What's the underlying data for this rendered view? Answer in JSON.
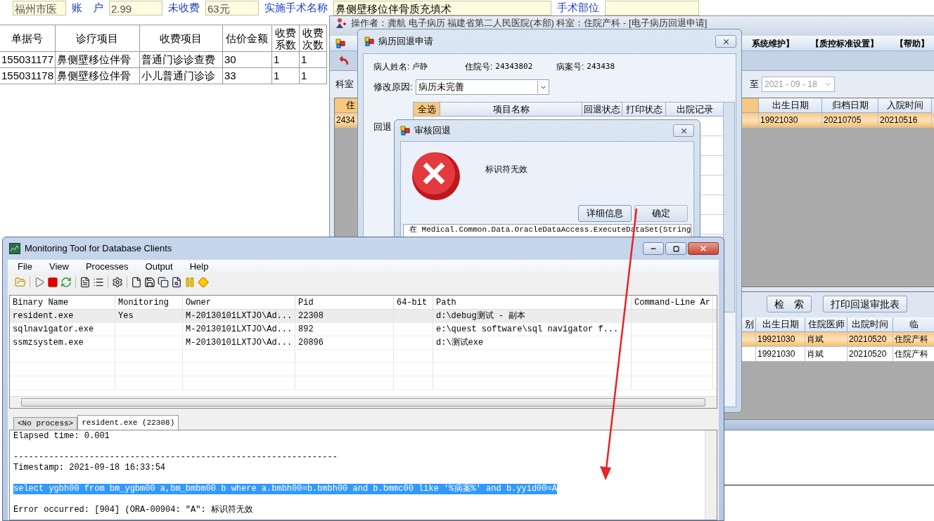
{
  "background_form": {
    "fields": [
      {
        "value": "福州市医"
      },
      {
        "label": "账　户",
        "value": "2.99"
      },
      {
        "label": "未收费",
        "value": "63元"
      },
      {
        "label": "实施手术名称",
        "value": "鼻侧壁移位伴骨质充填术"
      },
      {
        "label": "手术部位"
      }
    ],
    "fee_table": {
      "columns": [
        "单据号",
        "诊疗项目",
        "收费项目",
        "估价金额",
        "收费系数",
        "收费次数"
      ],
      "rows": [
        [
          "155031177",
          "鼻侧壁移位伴骨",
          "普通门诊诊查费",
          "30",
          "1",
          "1"
        ],
        [
          "155031178",
          "鼻侧壁移位伴骨",
          "小儿普通门诊诊",
          "33",
          "1",
          "1"
        ]
      ]
    }
  },
  "emr_window": {
    "title": "操作者：龚航 电子病历 福建省第二人民医院(本部) 科室：住院产科 - [电子病历回退申请]",
    "menu": [
      "系统维护】",
      "【质控标准设置】",
      "【帮助】"
    ],
    "dept_label": "科室",
    "date_to_label": "至",
    "date_to": "2021 - 09 - 18",
    "archive_grid": {
      "columns": [
        "住",
        "出生日期",
        "归档日期",
        "入院时间"
      ],
      "rows": [
        {
          "cells": [
            "2434",
            "19921030",
            "20210705",
            "20210516"
          ],
          "selected": true
        }
      ]
    },
    "buttons": [
      "检　索",
      "打印回退审批表"
    ],
    "discharge_grid": {
      "columns": [
        "别",
        "出生日期",
        "住院医师",
        "出院时间",
        "临"
      ],
      "rows": [
        {
          "cells": [
            "",
            "19921030",
            "肖斌",
            "20210520",
            "住院产科"
          ],
          "selected": true
        },
        {
          "cells": [
            "",
            "19921030",
            "肖斌",
            "20210520",
            "住院产科"
          ],
          "selected": false
        }
      ]
    }
  },
  "apply_dialog": {
    "title": "病历回退申请",
    "patient": [
      {
        "label": "病人姓名:",
        "value": "卢静"
      },
      {
        "label": "住院号:",
        "value": "24343802"
      },
      {
        "label": "病案号:",
        "value": "243438"
      }
    ],
    "reason_label": "修改原因:",
    "reason": "病历未完善",
    "side_label": "回退",
    "items_columns": [
      "全选",
      "项目名称",
      "回退状态",
      "打印状态",
      "出院记录"
    ]
  },
  "error_dialog": {
    "title": "审核回退",
    "message": "标识符无效",
    "buttons": [
      "详细信息",
      "确定"
    ],
    "detail": "在 Medical.Common.Data.OracleDataAccess.ExecuteDataSet(String"
  },
  "monitor": {
    "title": "Monitoring Tool for Database Clients",
    "menu": [
      "File",
      "View",
      "Processes",
      "Output",
      "Help"
    ],
    "columns": [
      "Binary Name",
      "Monitoring",
      "Owner",
      "Pid",
      "64-bit",
      "Path",
      "Command-Line Ar"
    ],
    "rows": [
      {
        "binary": "resident.exe",
        "monitoring": "Yes",
        "owner": "M-20130101LXTJO\\Ad...",
        "pid": "22308",
        "path": "d:\\debug测试 - 副本",
        "selected": true
      },
      {
        "binary": "sqlnavigator.exe",
        "owner": "M-20130101LXTJO\\Ad...",
        "pid": "892",
        "path": "e:\\quest software\\sql navigator f...",
        "selected": false
      },
      {
        "binary": "ssmzsystem.exe",
        "owner": "M-20130101LXTJO\\Ad...",
        "pid": "20896",
        "path": "d:\\测试exe",
        "selected": false
      }
    ],
    "tabs": [
      {
        "label": "<No process>",
        "selected": false
      },
      {
        "label": "resident.exe (22308)",
        "selected": true
      }
    ],
    "log": [
      {
        "kind": "text",
        "text": "Elapsed time: 0.001"
      },
      {
        "kind": "blank"
      },
      {
        "kind": "text",
        "text": "----------------------------------------------------------------"
      },
      {
        "kind": "text",
        "text": "Timestamp: 2021-09-18 16:33:54"
      },
      {
        "kind": "blank"
      },
      {
        "kind": "highlight",
        "text": "select ygbh00 from bm_ygbm00 a,bm_bmbm00 b where a.bmbh00=b.bmbh00 and b.bmmc00 like '%病案%' and b.yyid00=A"
      },
      {
        "kind": "blank"
      },
      {
        "kind": "text",
        "text": "Error occurred: [904] (ORA-00904: \"A\": 标识符无效"
      }
    ]
  }
}
